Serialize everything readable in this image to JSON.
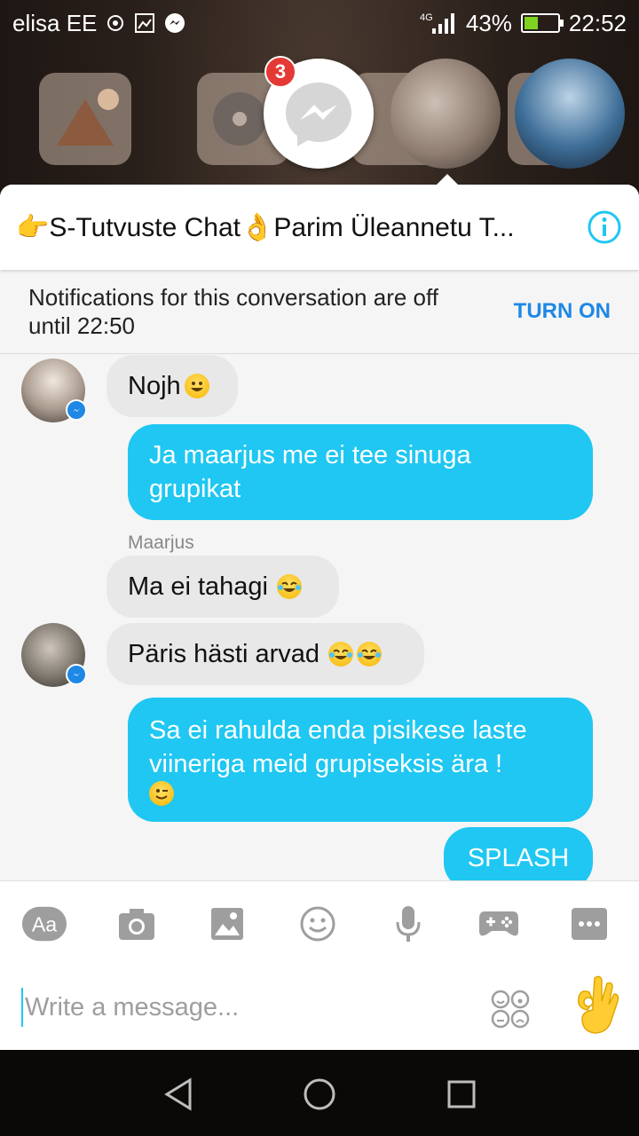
{
  "status_bar": {
    "carrier": "elisa EE",
    "network": "4G",
    "battery_percent": "43%",
    "battery_level": 0.43,
    "time": "22:52"
  },
  "chat_heads": {
    "unread_count": "3"
  },
  "header": {
    "title": "👉S-Tutvuste Chat👌Parim Üleannetu T..."
  },
  "notice": {
    "text": "Notifications for this conversation are off until 22:50",
    "action": "TURN ON"
  },
  "messages": [
    {
      "direction": "in",
      "text": "Nojh",
      "emoji": "grinning"
    },
    {
      "direction": "out",
      "text_line1": "Ja maarjus me ei tee sinuga",
      "text_line2": "grupikat"
    },
    {
      "direction": "in",
      "sender": "Maarjus",
      "text": "Ma ei tahagi",
      "emoji": "tears-of-joy"
    },
    {
      "direction": "in",
      "text": "Päris hästi arvad",
      "emoji": "tears-of-joy x2"
    },
    {
      "direction": "out",
      "text_line1": "Sa ei rahulda enda pisikese laste",
      "text_line2": "viineriga meid grupiseksis ära !",
      "emoji": "winking"
    },
    {
      "direction": "out",
      "text": "SPLASH"
    }
  ],
  "composer": {
    "placeholder": "Write a message..."
  },
  "colors": {
    "outgoing_bubble": "#1fc7f2",
    "incoming_bubble": "#e8e8e8",
    "accent": "#1e88e5",
    "badge": "#e53935"
  },
  "toolbar_icons": [
    "text-format-icon",
    "camera-icon",
    "image-icon",
    "sticker-icon",
    "microphone-icon",
    "game-icon",
    "more-icon"
  ]
}
